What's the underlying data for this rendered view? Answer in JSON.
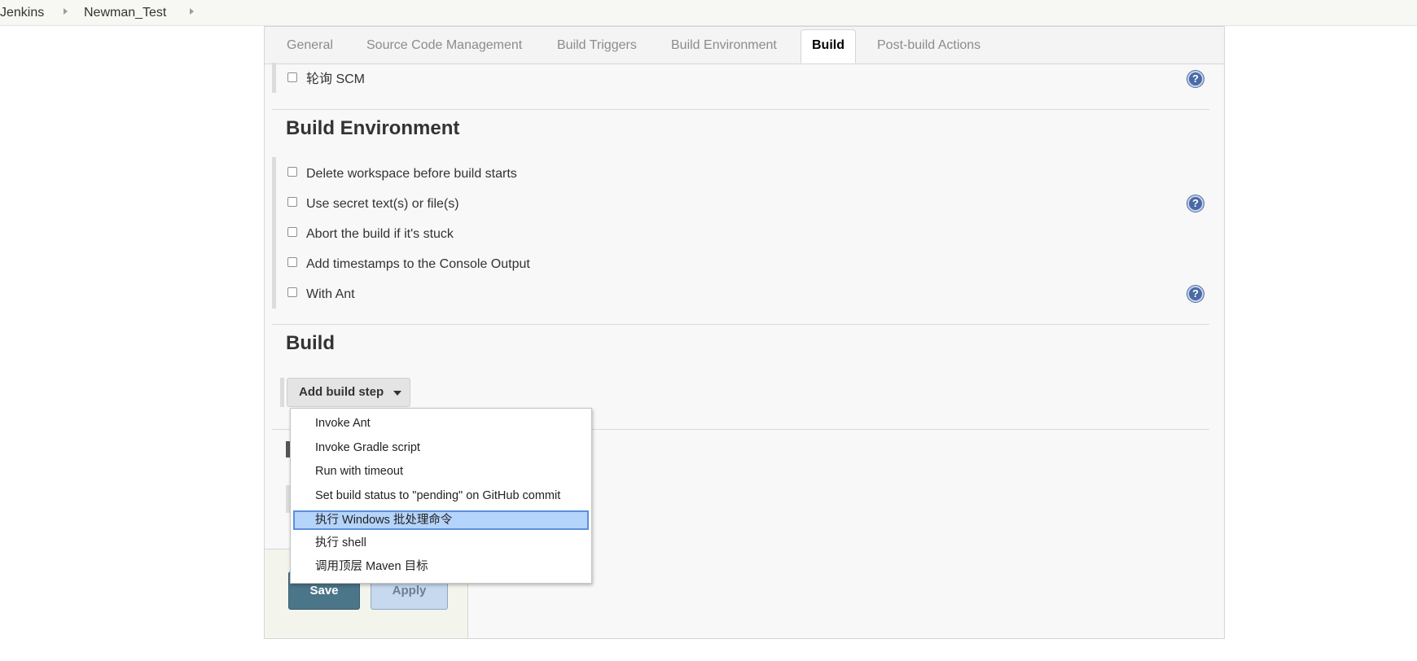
{
  "breadcrumb": {
    "items": [
      "Jenkins",
      "Newman_Test"
    ]
  },
  "tabs": [
    {
      "label": "General"
    },
    {
      "label": "Source Code Management"
    },
    {
      "label": "Build Triggers"
    },
    {
      "label": "Build Environment"
    },
    {
      "label": "Build",
      "active": true
    },
    {
      "label": "Post-build Actions"
    }
  ],
  "build_triggers": {
    "poll_scm": "轮询 SCM"
  },
  "build_environment": {
    "title": "Build Environment",
    "options": [
      "Delete workspace before build starts",
      "Use secret text(s) or file(s)",
      "Abort the build if it's stuck",
      "Add timestamps to the Console Output",
      "With Ant"
    ]
  },
  "build": {
    "title": "Build",
    "add_step_label": "Add build step",
    "menu_items": [
      "Invoke Ant",
      "Invoke Gradle script",
      "Run with timeout",
      "Set build status to \"pending\" on GitHub commit",
      "执行 Windows 批处理命令",
      "执行 shell",
      "调用顶层 Maven 目标"
    ],
    "selected_index": 4
  },
  "actions": {
    "save_label": "Save",
    "apply_label": "Apply"
  },
  "help_glyph": "?",
  "colors": {
    "save_button": "#4b7589",
    "apply_button": "#c6d9ee",
    "selected_item": "#b5d4fb",
    "help_icon": "#4a6aa5"
  }
}
